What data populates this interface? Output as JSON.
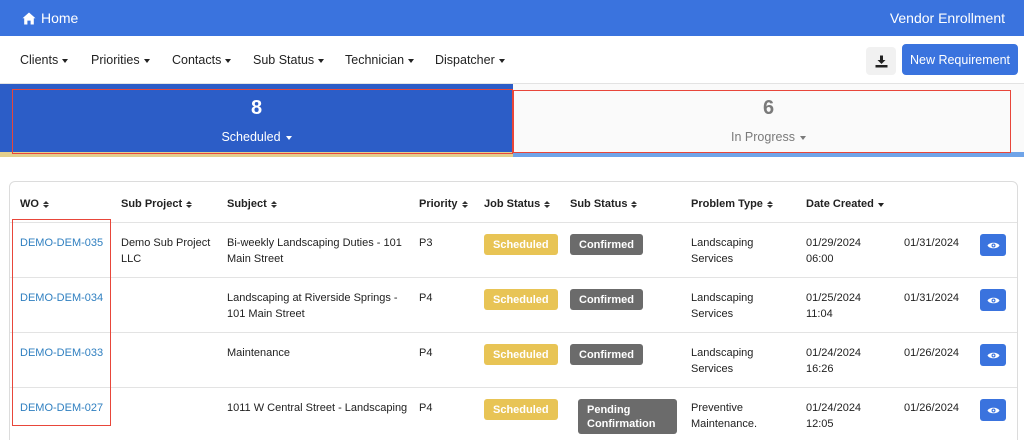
{
  "topbar": {
    "home_label": "Home",
    "vendor_label": "Vendor Enrollment",
    "bg": "#3a73de"
  },
  "filters": [
    "Clients",
    "Priorities",
    "Contacts",
    "Sub Status",
    "Technician",
    "Dispatcher"
  ],
  "toolbar": {
    "download_icon": "download-icon",
    "new_requirement_label": "New Requirement"
  },
  "stats": {
    "scheduled": {
      "count": "8",
      "label": "Scheduled"
    },
    "in_progress": {
      "count": "6",
      "label": "In Progress"
    }
  },
  "table": {
    "headers": [
      "WO",
      "Sub Project",
      "Subject",
      "Priority",
      "Job Status",
      "Sub Status",
      "Problem Type",
      "Date Created"
    ],
    "rows": [
      {
        "wo": "DEMO-DEM-035",
        "sub_project": [
          "Demo Sub Project",
          "LLC"
        ],
        "subject": [
          "Bi-weekly Landscaping Duties - 101",
          "Main Street"
        ],
        "priority": "P3",
        "job_status": "Scheduled",
        "sub_status": [
          "Confirmed"
        ],
        "problem_type": [
          "Landscaping",
          "Services"
        ],
        "date_created": [
          "01/29/2024",
          "06:00"
        ],
        "due_date": "01/31/2024"
      },
      {
        "wo": "DEMO-DEM-034",
        "sub_project": [
          "",
          ""
        ],
        "subject": [
          "Landscaping at Riverside Springs -",
          "101 Main Street"
        ],
        "priority": "P4",
        "job_status": "Scheduled",
        "sub_status": [
          "Confirmed"
        ],
        "problem_type": [
          "Landscaping",
          "Services"
        ],
        "date_created": [
          "01/25/2024",
          "11:04"
        ],
        "due_date": "01/31/2024"
      },
      {
        "wo": "DEMO-DEM-033",
        "sub_project": [
          "",
          ""
        ],
        "subject": [
          "Maintenance",
          ""
        ],
        "priority": "P4",
        "job_status": "Scheduled",
        "sub_status": [
          "Confirmed"
        ],
        "problem_type": [
          "Landscaping",
          "Services"
        ],
        "date_created": [
          "01/24/2024",
          "16:26"
        ],
        "due_date": "01/26/2024"
      },
      {
        "wo": "DEMO-DEM-027",
        "sub_project": [
          "",
          ""
        ],
        "subject": [
          "1011 W Central Street - Landscaping",
          ""
        ],
        "priority": "P4",
        "job_status": "Scheduled",
        "sub_status": [
          "Pending",
          "Confirmation"
        ],
        "problem_type": [
          "Preventive",
          "Maintenance."
        ],
        "date_created": [
          "01/24/2024",
          "12:05"
        ],
        "due_date": "01/26/2024"
      }
    ]
  },
  "colors": {
    "primary": "#3a73de",
    "scheduled_tab": "#2c5dc7",
    "job_status_badge": "#e8c455",
    "sub_status_badge": "#6b6b6b",
    "link": "#2f7fc0",
    "highlight_box": "#e8463a"
  }
}
